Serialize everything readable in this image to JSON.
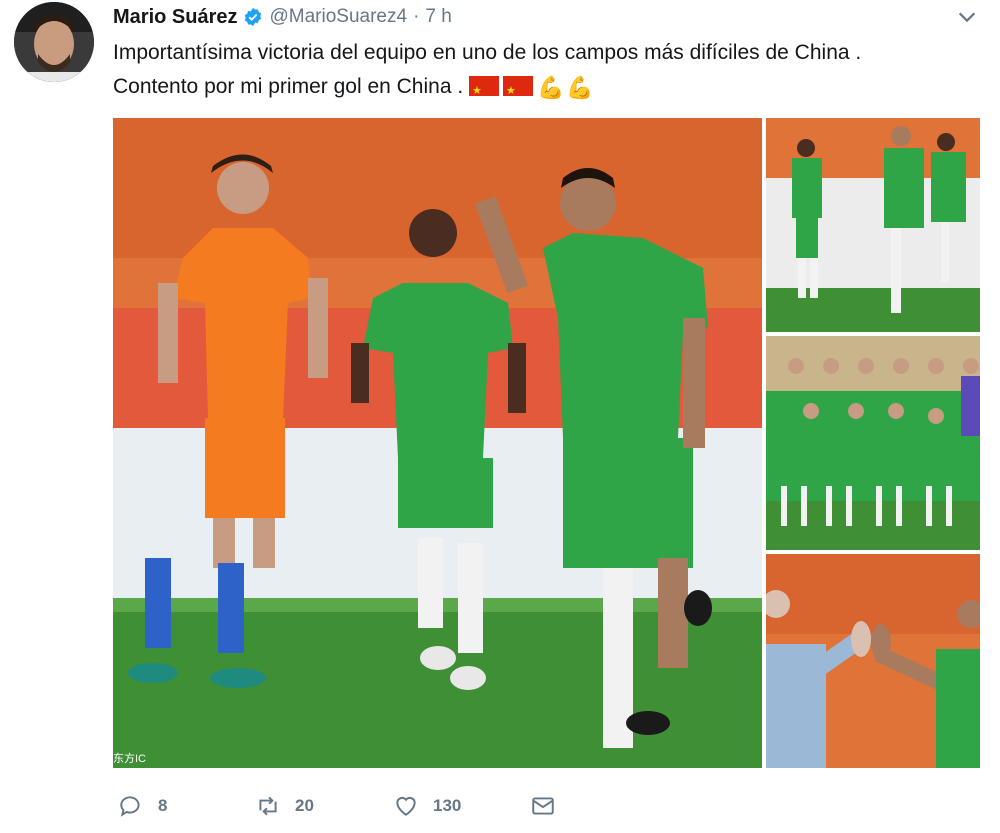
{
  "tweet": {
    "author_name": "Mario Suárez",
    "handle": "@MarioSuarez4",
    "separator": "·",
    "time": "7 h",
    "text_line1": "Importantísima victoria del equipo en uno de los campos más difíciles de China .",
    "text_line2": "Contento por mi primer gol en China .",
    "emojis": [
      "flag-china-icon",
      "flag-china-icon",
      "flexed-biceps-icon",
      "flexed-biceps-icon"
    ],
    "photo_watermark": "东方IC",
    "colors": {
      "verified": "#1da1f2",
      "secondary_text": "#657786",
      "jersey_green": "#2fa548",
      "jersey_orange": "#f47b20"
    }
  },
  "actions": {
    "reply_count": "8",
    "retweet_count": "20",
    "like_count": "130"
  }
}
